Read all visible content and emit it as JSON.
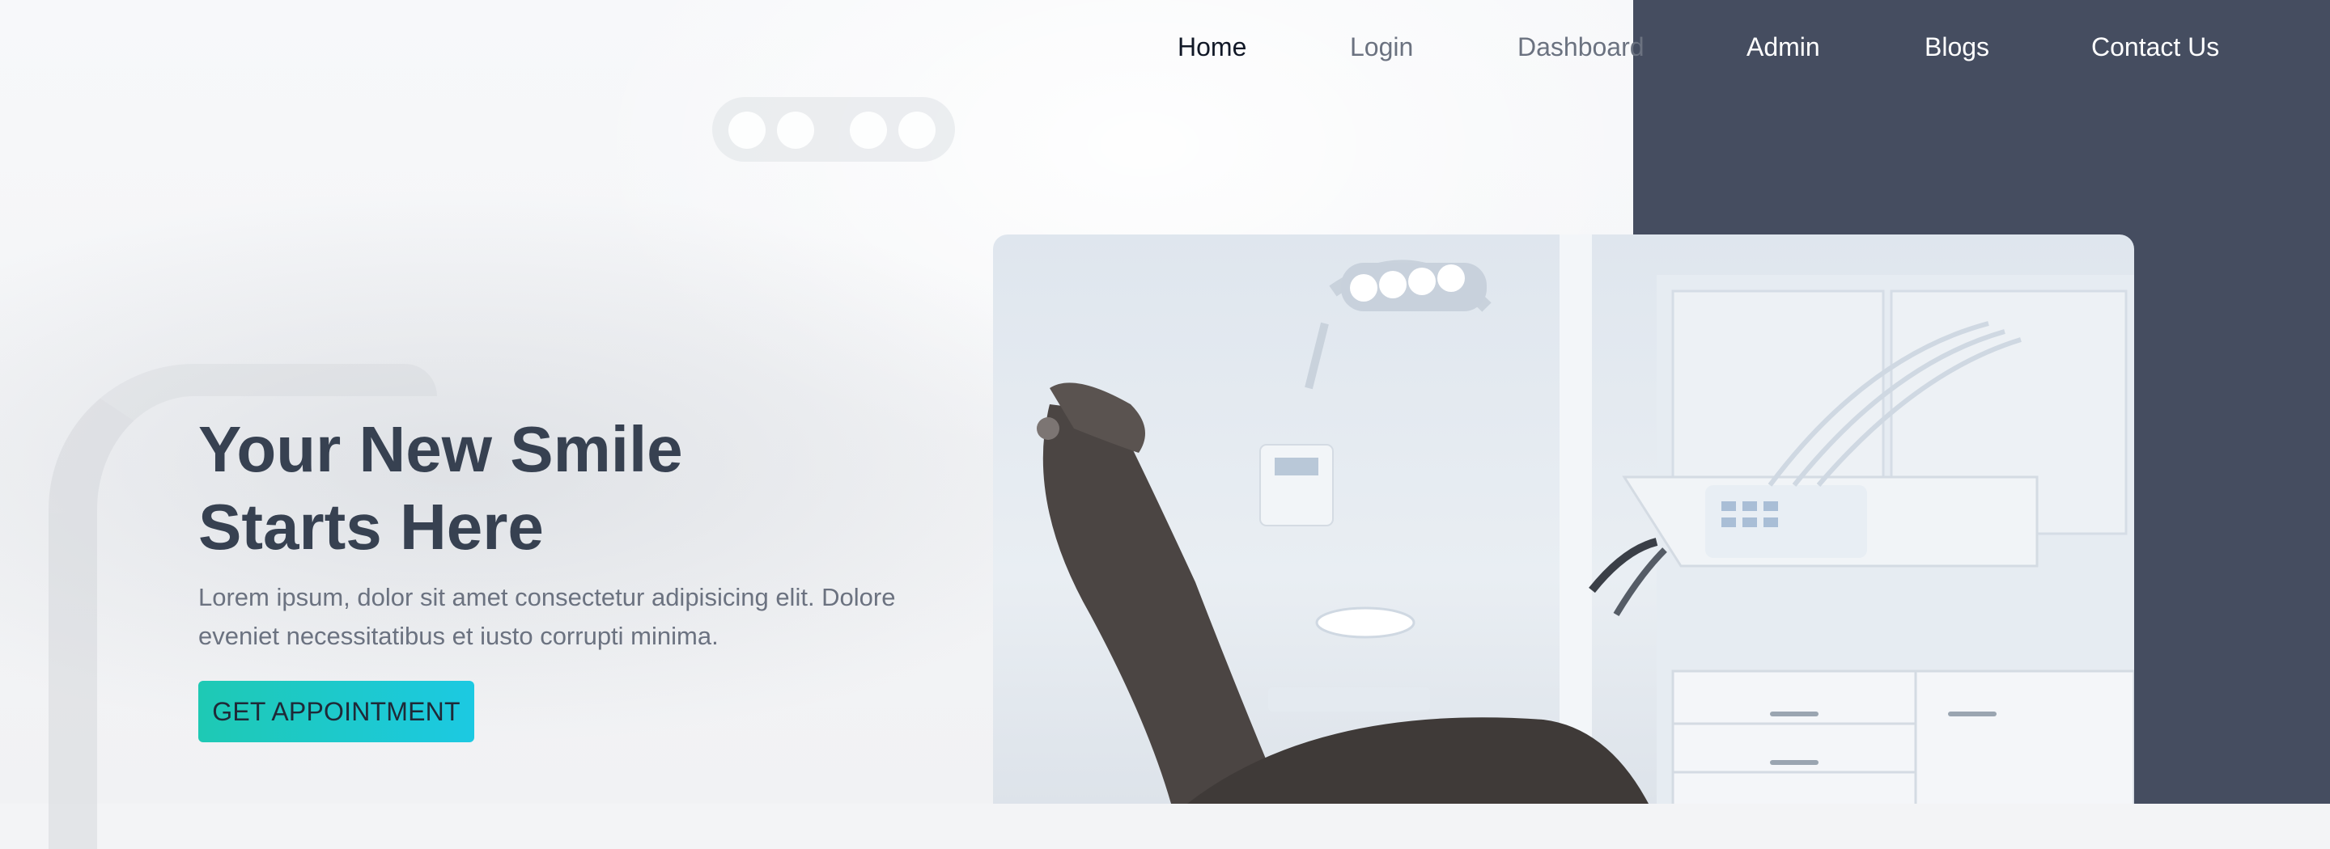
{
  "nav": {
    "items": [
      {
        "label": "Home"
      },
      {
        "label": "Login"
      },
      {
        "label": "Dashboard"
      },
      {
        "label": "Admin"
      },
      {
        "label": "Blogs"
      },
      {
        "label": "Contact Us"
      }
    ]
  },
  "hero": {
    "title_line1": "Your New Smile",
    "title_line2": "Starts Here",
    "description": "Lorem ipsum, dolor sit amet consectetur adipisicing elit. Dolore eveniet necessitatibus et iusto corrupti minima.",
    "cta_label": "GET APPOINTMENT"
  },
  "colors": {
    "right_panel": "#454d60",
    "heading": "#374151",
    "cta_gradient_start": "#1ec9b4",
    "cta_gradient_end": "#1cc9e2"
  }
}
